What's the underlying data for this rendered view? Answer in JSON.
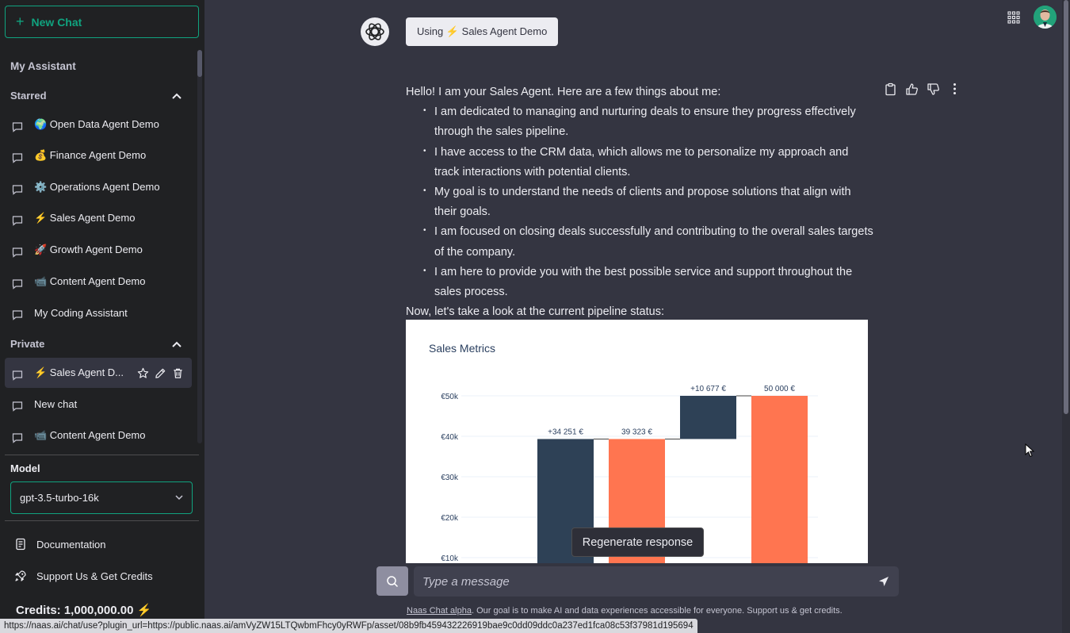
{
  "sidebar": {
    "new_chat_label": "New Chat",
    "my_assistant": "My Assistant",
    "starred_title": "Starred",
    "starred": [
      {
        "label": "🌍 Open Data Agent Demo"
      },
      {
        "label": "💰 Finance Agent Demo"
      },
      {
        "label": "⚙️ Operations Agent Demo"
      },
      {
        "label": "⚡ Sales Agent Demo"
      },
      {
        "label": "🚀 Growth Agent Demo"
      },
      {
        "label": "📹 Content Agent Demo"
      },
      {
        "label": "My Coding Assistant"
      }
    ],
    "private_title": "Private",
    "private": [
      {
        "label": "⚡ Sales Agent D..."
      },
      {
        "label": "New chat"
      },
      {
        "label": "📹 Content Agent Demo"
      }
    ],
    "model_label": "Model",
    "model_value": "gpt-3.5-turbo-16k",
    "documentation": "Documentation",
    "support": "Support Us & Get Credits",
    "credits": "Credits: 1,000,000.00 ⚡"
  },
  "header": {
    "using_badge": "Using ⚡ Sales Agent Demo"
  },
  "message": {
    "intro": "Hello! I am your Sales Agent. Here are a few things about me:",
    "bullets": [
      "I am dedicated to managing and nurturing deals to ensure they progress effectively through the sales pipeline.",
      "I have access to the CRM data, which allows me to personalize my approach and track interactions with potential clients.",
      "My goal is to understand the needs of clients and propose solutions that align with their goals.",
      "I am focused on closing deals successfully and contributing to the overall sales targets of the company.",
      "I am here to provide you with the best possible service and support throughout the sales process."
    ],
    "outro": "Now, let's take a look at the current pipeline status:"
  },
  "chart_data": {
    "type": "bar",
    "title": "Sales Metrics",
    "y_ticks": [
      "€50k",
      "€40k",
      "€30k",
      "€20k",
      "€10k"
    ],
    "ylim": [
      0,
      50000
    ],
    "bars": [
      {
        "label": "+34 251 €",
        "base": 0,
        "value": 39323,
        "color": "#2e4156"
      },
      {
        "label": "39 323 €",
        "base": 0,
        "value": 39323,
        "color": "#ff7550"
      },
      {
        "label": "+10 677 €",
        "base": 39323,
        "value": 50000,
        "color": "#2e4156"
      },
      {
        "label": "50 000 €",
        "base": 0,
        "value": 50000,
        "color": "#ff7550"
      }
    ],
    "colors": {
      "increase": "#2e4156",
      "total": "#ff7550"
    }
  },
  "regenerate_label": "Regenerate response",
  "input": {
    "placeholder": "Type a message"
  },
  "footnote": {
    "link": "Naas Chat alpha",
    "text": ". Our goal is to make AI and data experiences accessible for everyone. Support us & get credits."
  },
  "status_url": "https://naas.ai/chat/use?plugin_url=https://public.naas.ai/amVyZW15LTQwbmFhcy0yRWFp/asset/08b9fb459432226919bae9c0dd09ddc0a237ed1fca08c53f37981d195694"
}
